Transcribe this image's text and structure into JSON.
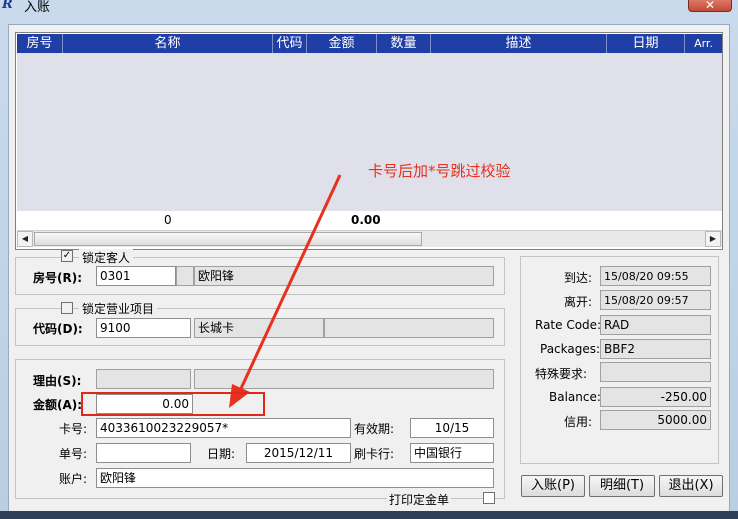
{
  "window": {
    "title": "入账",
    "logo": "R",
    "close_icon": "close-icon"
  },
  "grid": {
    "columns": [
      "房号",
      "名称",
      "代码",
      "金额",
      "数量",
      "描述",
      "日期",
      "Arr."
    ],
    "totals": {
      "quantity": "0",
      "amount": "0.00"
    }
  },
  "annotation": {
    "text": "卡号后加*号跳过校验",
    "color": "#e8301c"
  },
  "guest": {
    "lock_label": "锁定客人",
    "lock_checked": true,
    "lock_mark": "✓",
    "room_label": "房号(R):",
    "room": "0301",
    "room_extra": "",
    "guest_name": "欧阳锋"
  },
  "item": {
    "lock_label": "锁定营业项目",
    "lock_checked": false,
    "code_label": "代码(D):",
    "code": "9100",
    "code_name": "长城卡",
    "code_extra": ""
  },
  "payment": {
    "reason_label": "理由(S):",
    "reason_code": "",
    "reason_text": "",
    "amount_label": "金额(A):",
    "amount": "0.00",
    "card_label": "卡号:",
    "card_no": "4033610023229057*",
    "expiry_label": "有效期:",
    "expiry": "10/15",
    "slip_label": "单号:",
    "slip_no": "",
    "date_label": "日期:",
    "date": "2015/12/11",
    "bank_label": "刷卡行:",
    "bank": "中国银行",
    "account_label": "账户:",
    "account": "欧阳锋",
    "print_label": "打印定金单",
    "print_checked": false
  },
  "info": {
    "arrival_label": "到达:",
    "arrival": "15/08/20   09:55",
    "departure_label": "离开:",
    "departure": "15/08/20   09:57",
    "rate_label": "Rate Code:",
    "rate": "RAD",
    "packages_label": "Packages:",
    "packages": "BBF2",
    "special_label": "特殊要求:",
    "special": "",
    "balance_label": "Balance:",
    "balance": "-250.00",
    "credit_label": "信用:",
    "credit": "5000.00"
  },
  "buttons": {
    "post": "入账(P)",
    "detail": "明细(T)",
    "exit": "退出(X)"
  }
}
